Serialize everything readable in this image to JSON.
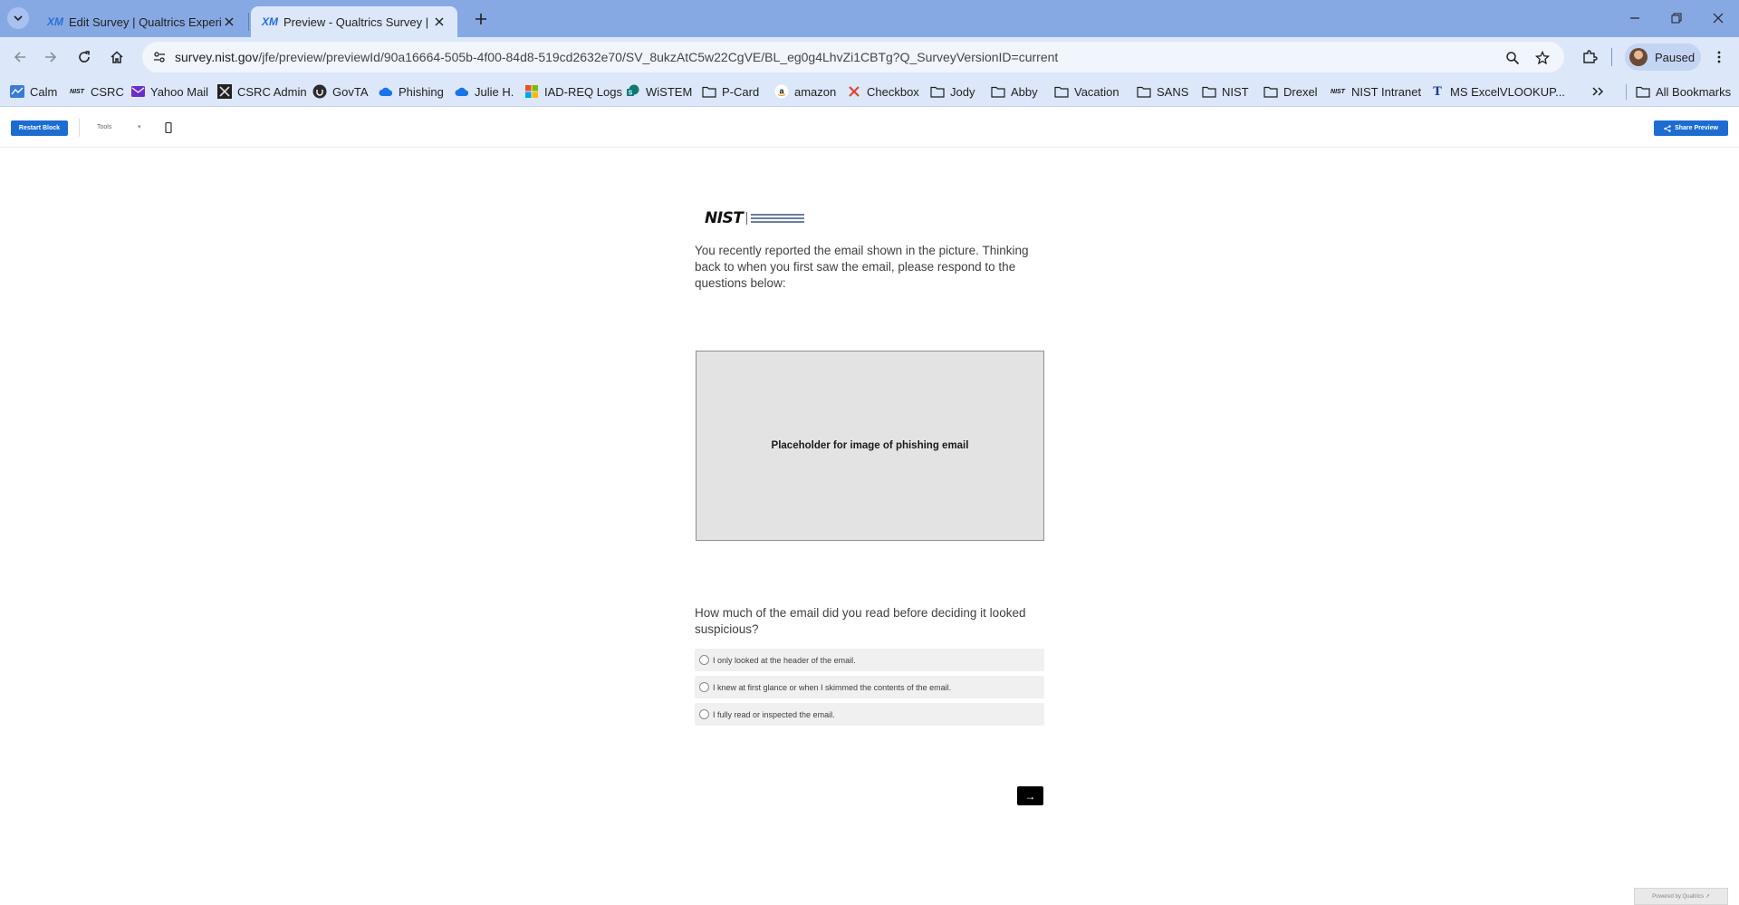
{
  "browser": {
    "tabs": [
      {
        "icon": "XM",
        "title": "Edit Survey | Qualtrics Experien",
        "active": false
      },
      {
        "icon": "XM",
        "title": "Preview - Qualtrics Survey | Qu",
        "active": true
      }
    ],
    "url": {
      "host": "survey.nist.gov",
      "path": "/jfe/preview/previewId/90a16664-505b-4f00-84d8-519cd2632e70/SV_8ukzAtC5w22CgVE/BL_eg0g4LhvZi1CBTg?Q_SurveyVersionID=current"
    },
    "profile_label": "Paused",
    "bookmarks": [
      {
        "label": "Calm",
        "icon": "calm-icon"
      },
      {
        "label": "CSRC",
        "icon": "nist-icon",
        "icon_text": "NIST"
      },
      {
        "label": "Yahoo Mail",
        "icon": "mail-icon"
      },
      {
        "label": "CSRC Admin",
        "icon": "csrc-admin-icon"
      },
      {
        "label": "GovTA",
        "icon": "govta-icon"
      },
      {
        "label": "Phishing",
        "icon": "cloud-icon"
      },
      {
        "label": "Julie H.",
        "icon": "cloud-icon"
      },
      {
        "label": "IAD-REQ Logs",
        "icon": "microsoft-icon"
      },
      {
        "label": "WiSTEM",
        "icon": "sharepoint-icon"
      },
      {
        "label": "P-Card",
        "icon": "folder-icon"
      },
      {
        "label": "amazon",
        "icon": "amazon-icon"
      },
      {
        "label": "Checkbox",
        "icon": "checkbox-icon"
      },
      {
        "label": "Jody",
        "icon": "folder-icon"
      },
      {
        "label": "Abby",
        "icon": "folder-icon"
      },
      {
        "label": "Vacation",
        "icon": "folder-icon"
      },
      {
        "label": "SANS",
        "icon": "folder-icon"
      },
      {
        "label": "NIST",
        "icon": "folder-icon"
      },
      {
        "label": "Drexel",
        "icon": "folder-icon"
      },
      {
        "label": "NIST Intranet",
        "icon": "nist-icon",
        "icon_text": "NIST"
      },
      {
        "label": "MS ExcelVLOOKUP...",
        "icon": "t-icon",
        "icon_text": "T"
      }
    ],
    "all_bookmarks_label": "All Bookmarks",
    "colors": {
      "frame": "#87a9e3",
      "toolbar": "#dce7fa"
    }
  },
  "qualtrics": {
    "restart_label": "Restart Block",
    "tools_label": "Tools",
    "share_label": "Share Preview",
    "accent": "#1d6dd1"
  },
  "survey": {
    "logo_text": "NIST",
    "intro": "You recently reported the email shown in the picture. Thinking back to when you first saw the email, please respond to the questions below:",
    "image_placeholder": "Placeholder for image of phishing email",
    "question": "How much of the email did you read before deciding it looked suspicious?",
    "choices": [
      "I only looked at the header of the email.",
      "I knew at first glance or when I skimmed the contents of the email.",
      "I fully read or inspected the email."
    ],
    "next_label": "→",
    "powered_by": "Powered by Qualtrics ↗"
  }
}
